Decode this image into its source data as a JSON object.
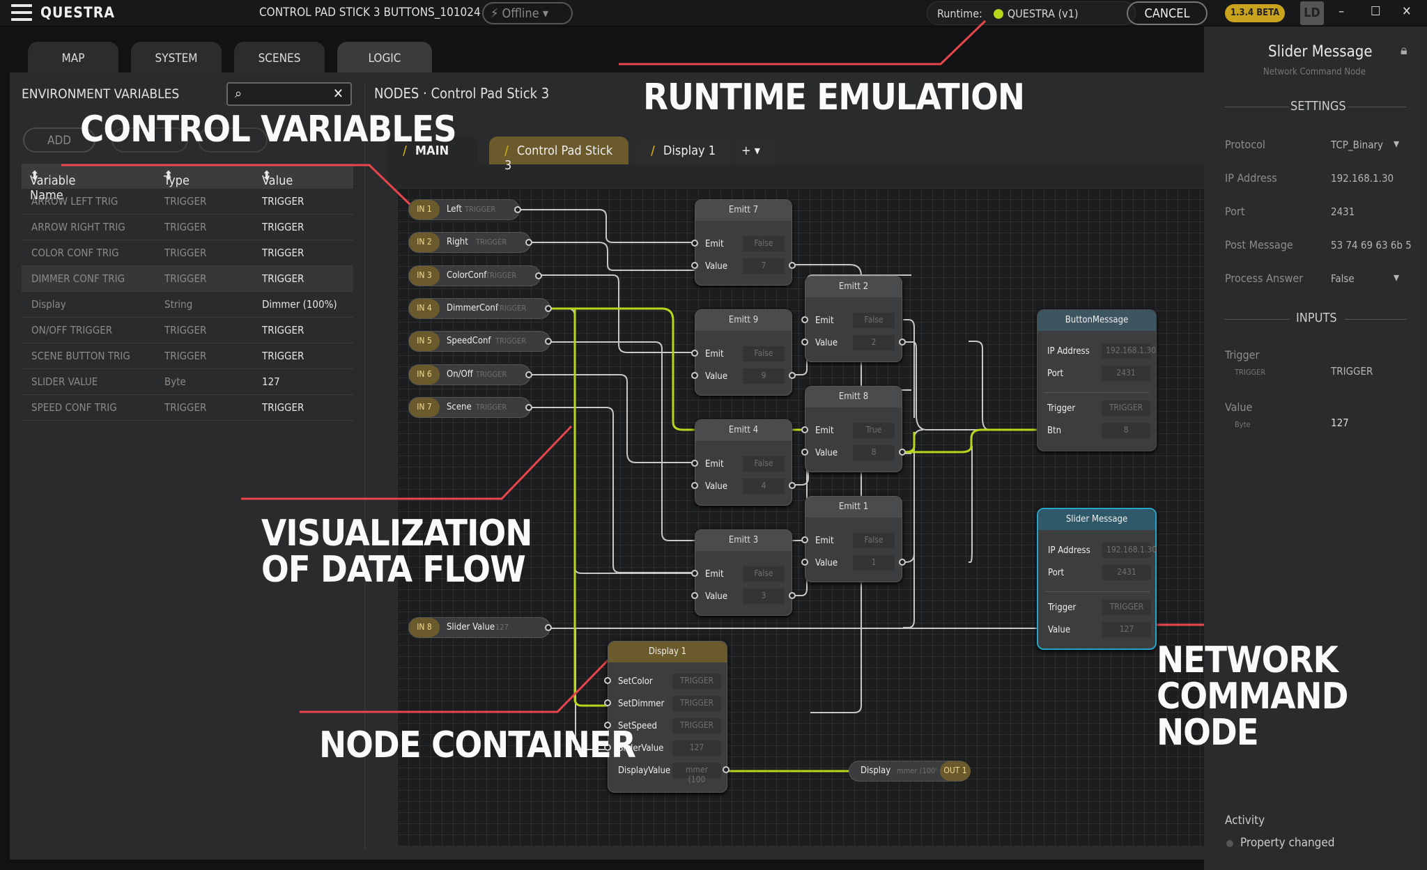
{
  "app": {
    "brand": "QUESTRA",
    "project": "CONTROL PAD STICK 3 BUTTONS_101024",
    "status": "Offline",
    "runtime_label": "Runtime:",
    "runtime_value": "QUESTRA (v1)",
    "cancel": "CANCEL",
    "version": "1.3.4 BETA",
    "user": "LD"
  },
  "main_tabs": [
    "MAP",
    "SYSTEM",
    "SCENES",
    "LOGIC"
  ],
  "env": {
    "title": "ENVIRONMENT VARIABLES",
    "add": "ADD",
    "columns": [
      "Variable Name",
      "Type",
      "Value"
    ],
    "rows": [
      [
        "ARROW LEFT TRIG",
        "TRIGGER",
        "TRIGGER"
      ],
      [
        "ARROW RIGHT TRIG",
        "TRIGGER",
        "TRIGGER"
      ],
      [
        "COLOR CONF TRIG",
        "TRIGGER",
        "TRIGGER"
      ],
      [
        "DIMMER CONF TRIG",
        "TRIGGER",
        "TRIGGER"
      ],
      [
        "Display",
        "String",
        "Dimmer (100%)"
      ],
      [
        "ON/OFF TRIGGER",
        "TRIGGER",
        "TRIGGER"
      ],
      [
        "SCENE BUTTON TRIG",
        "TRIGGER",
        "TRIGGER"
      ],
      [
        "SLIDER VALUE",
        "Byte",
        "127"
      ],
      [
        "SPEED CONF TRIG",
        "TRIGGER",
        "TRIGGER"
      ]
    ]
  },
  "breadcrumb": {
    "root": "NODES",
    "sep": "·",
    "current": "Control Pad Stick 3"
  },
  "node_tabs": [
    "MAIN",
    "Control Pad Stick 3",
    "Display 1",
    "+"
  ],
  "inputs": [
    {
      "tag": "IN 1",
      "label": "Left",
      "type": "TRIGGER"
    },
    {
      "tag": "IN 2",
      "label": "Right",
      "type": "TRIGGER"
    },
    {
      "tag": "IN 3",
      "label": "ColorConf",
      "type": "TRIGGER"
    },
    {
      "tag": "IN 4",
      "label": "DimmerConf",
      "type": "TRIGGER"
    },
    {
      "tag": "IN 5",
      "label": "SpeedConf",
      "type": "TRIGGER"
    },
    {
      "tag": "IN 6",
      "label": "On/Off",
      "type": "TRIGGER"
    },
    {
      "tag": "IN 7",
      "label": "Scene",
      "type": "TRIGGER"
    },
    {
      "tag": "IN 8",
      "label": "Slider Value",
      "type": "127"
    }
  ],
  "emitts": [
    {
      "title": "Emitt 7",
      "emit": "False",
      "value": "7"
    },
    {
      "title": "Emitt 2",
      "emit": "False",
      "value": "2"
    },
    {
      "title": "Emitt 9",
      "emit": "False",
      "value": "9"
    },
    {
      "title": "Emitt 8",
      "emit": "True",
      "value": "8"
    },
    {
      "title": "Emitt 4",
      "emit": "False",
      "value": "4"
    },
    {
      "title": "Emitt 1",
      "emit": "False",
      "value": "1"
    },
    {
      "title": "Emitt 3",
      "emit": "False",
      "value": "3"
    }
  ],
  "node_labels": {
    "emit": "Emit",
    "value": "Value"
  },
  "button_msg": {
    "title": "ButtonMessage",
    "ip_label": "IP Address",
    "ip": "192.168.1.30",
    "port_label": "Port",
    "port": "2431",
    "trigger_label": "Trigger",
    "trigger": "TRIGGER",
    "btn_label": "Btn",
    "btn": "8"
  },
  "slider_msg": {
    "title": "Slider Message",
    "ip_label": "IP Address",
    "ip": "192.168.1.30",
    "port_label": "Port",
    "port": "2431",
    "trigger_label": "Trigger",
    "trigger": "TRIGGER",
    "value_label": "Value",
    "value": "127"
  },
  "display_node": {
    "title": "Display 1",
    "rows": [
      [
        "SetColor",
        "TRIGGER"
      ],
      [
        "SetDimmer",
        "TRIGGER"
      ],
      [
        "SetSpeed",
        "TRIGGER"
      ],
      [
        "SliderValue",
        "127"
      ],
      [
        "DisplayValue",
        "mmer (100"
      ]
    ]
  },
  "output": {
    "label": "Display",
    "value": "mmer (100'",
    "tag": "OUT 1"
  },
  "rpanel": {
    "title": "Slider Message",
    "subtitle": "Network Command Node",
    "settings": "SETTINGS",
    "inputs": "INPUTS",
    "fields": [
      [
        "Protocol",
        "TCP_Binary"
      ],
      [
        "IP Address",
        "192.168.1.30"
      ],
      [
        "Port",
        "2431"
      ],
      [
        "Post Message",
        "53 74 69 63 6b 5"
      ],
      [
        "Process Answer",
        "False"
      ]
    ],
    "in_trigger": "Trigger",
    "in_trigger_type": "TRIGGER",
    "in_trigger_val": "TRIGGER",
    "in_value": "Value",
    "in_value_type": "Byte",
    "in_value_val": "127",
    "activity": "Activity",
    "activity_item": "Property changed"
  },
  "annotations": {
    "control": "CONTROL VARIABLES",
    "runtime": "RUNTIME EMULATION",
    "viz1": "VISUALIZATION",
    "viz2": "OF DATA FLOW",
    "container": "NODE CONTAINER",
    "net1": "NETWORK",
    "net2": "COMMAND NODE"
  },
  "colors": {
    "accent": "#c9a31e",
    "flow": "#b8d61c",
    "annotation_line": "#e8464c",
    "net_node": "#2aa3c9"
  }
}
